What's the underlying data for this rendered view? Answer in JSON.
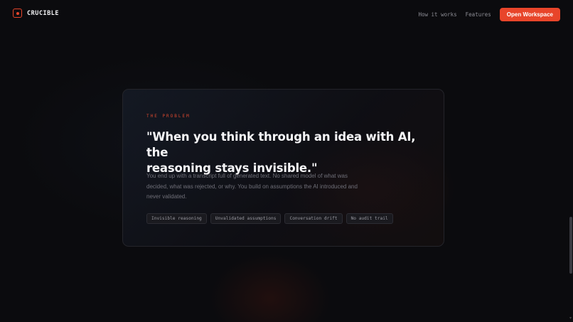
{
  "brand": {
    "name": "CRUCIBLE",
    "accent": "#e8452a"
  },
  "nav": {
    "links": [
      "How it works",
      "Features"
    ],
    "cta_label": "Open Workspace"
  },
  "problem": {
    "eyebrow": "THE PROBLEM",
    "headline_line1": "\"When you think through an idea with AI, the",
    "headline_line2": "reasoning stays invisible.\"",
    "description": "You end up with a transcript full of generated text. No shared model of what was decided, what was rejected, or why. You build on assumptions the AI introduced and never validated.",
    "tags": [
      "Invisible reasoning",
      "Unvalidated assumptions",
      "Conversation drift",
      "No audit trail"
    ]
  }
}
